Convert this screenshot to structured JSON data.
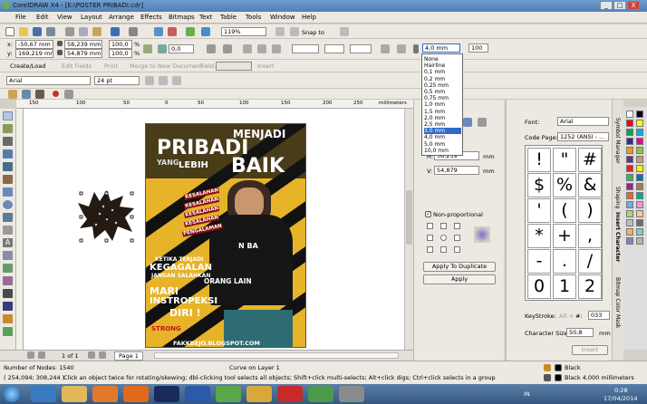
{
  "window": {
    "title": "CorelDRAW X4 - [E:\\POSTER PRIBADI.cdr]",
    "min": "_",
    "max": "□",
    "close": "X"
  },
  "menu": [
    "File",
    "Edit",
    "View",
    "Layout",
    "Arrange",
    "Effects",
    "Bitmaps",
    "Text",
    "Table",
    "Tools",
    "Window",
    "Help"
  ],
  "standard_bar": {
    "zoom": "119%",
    "snap": "Snap to"
  },
  "property_bar": {
    "x_label": "x:",
    "x": "-50,67 mm",
    "y_label": "y:",
    "y": "169,219 mm",
    "w": "58,239 mm",
    "h": "54,879 mm",
    "sx": "100,0",
    "sy": "100,0",
    "pct": "%",
    "angle": "0,0",
    "outline_width": "4,0 mm",
    "opacity": "100"
  },
  "bar3": {
    "create_load": "Create/Load",
    "edit_fields": "Edit Fields",
    "print": "Print",
    "merge": "Merge to New Document",
    "field": "Field:",
    "insert": "Insert"
  },
  "text_bar": {
    "font": "Arial",
    "size": "24 pt"
  },
  "outline_dropdown": {
    "items": [
      "None",
      "Hairline",
      "0,1 mm",
      "0,2 mm",
      "0,25 mm",
      "0,5 mm",
      "0,75 mm",
      "1,0 mm",
      "1,5 mm",
      "2,0 mm",
      "2,5 mm",
      "3,0 mm",
      "4,0 mm",
      "5,0 mm",
      "10,0 mm"
    ],
    "selected": "3,0 mm"
  },
  "ruler": {
    "unit": "millimeters",
    "ticks": [
      "150",
      "100",
      "50",
      "0",
      "50",
      "100",
      "150",
      "200",
      "250"
    ]
  },
  "poster": {
    "line1": "MENJADI",
    "line2": "PRIBADI",
    "line3a": "YANG",
    "line3b": "LEBIH",
    "line3c": "BAIK",
    "stamps": [
      "KESALAHAN",
      "KESALAHAN",
      "KESALAHAN",
      "KESALAHAN",
      "PENGALAMAN"
    ],
    "shirt": "N BA",
    "q1": "KETIKA TERJADI",
    "q2": "KEGAGALAN",
    "q3": "JANGAN SALAHKAN",
    "q4": "ORANG LAIN",
    "q5": "MARI",
    "q6": "INSTROPEKSI",
    "q7": "DIRI !",
    "strong": "STRONG",
    "url": "FAKKBEJO.BLOGSPOT.COM"
  },
  "page_nav": {
    "current": "1 of 1",
    "page_tab": "Page 1"
  },
  "transform_panel": {
    "x_label": "H:",
    "x": "58,239",
    "y_label": "V:",
    "y": "54,879",
    "unit": "mm",
    "nonprop": "Non-proportional",
    "apply_dup": "Apply To Duplicate",
    "apply": "Apply"
  },
  "char_panel": {
    "font_label": "Font:",
    "font": "Arial",
    "codepage_label": "Code Page:",
    "codepage": "1252 (ANSI - ...",
    "glyphs": [
      "!",
      "\"",
      "#",
      "$",
      "%",
      "&",
      "'",
      "(",
      ")",
      "*",
      "+",
      ",",
      "-",
      ".",
      "/",
      "0",
      "1",
      "2"
    ],
    "keystroke_label": "KeyStroke:",
    "keystroke_alt": "Alt +",
    "keystroke_hash": "#:",
    "keystroke": "033",
    "size_label": "Character Size:",
    "size": "50,8",
    "size_unit": "mm",
    "insert": "Insert"
  },
  "dock_tabs": [
    "Symbol Manager",
    "Shaping",
    "Insert Character",
    "Bitmap Color Mask"
  ],
  "palette_colors": [
    "#ffffff",
    "#000000",
    "#ff0000",
    "#ffff00",
    "#00a651",
    "#00aeef",
    "#2e3192",
    "#ec008c",
    "#f7941d",
    "#8dc63f",
    "#662d91",
    "#c69c6d",
    "#ed1c24",
    "#fff200",
    "#39b54a",
    "#0072bc",
    "#92278f",
    "#a67c52",
    "#f26522",
    "#00a99d",
    "#7da7d9",
    "#f49ac2",
    "#acd373",
    "#fdc689",
    "#bcbec0",
    "#6d6e71",
    "#fbaf5d",
    "#7accc8",
    "#8781bd",
    "#c7b299"
  ],
  "status": {
    "nodes": "Number of Nodes: 1540",
    "layer": "Curve on Layer 1",
    "coords": "( 254,094; 308,244 )",
    "hint": "Click an object twice for rotating/skewing; dbl-clicking tool selects all objects; Shift+click multi-selects; Alt+click digs; Ctrl+click selects in a group",
    "fill": "Black",
    "outline": "Black  4,000 millimeters"
  },
  "taskbar": {
    "lang": "IN",
    "time": "0:28",
    "date": "17/04/2014"
  }
}
